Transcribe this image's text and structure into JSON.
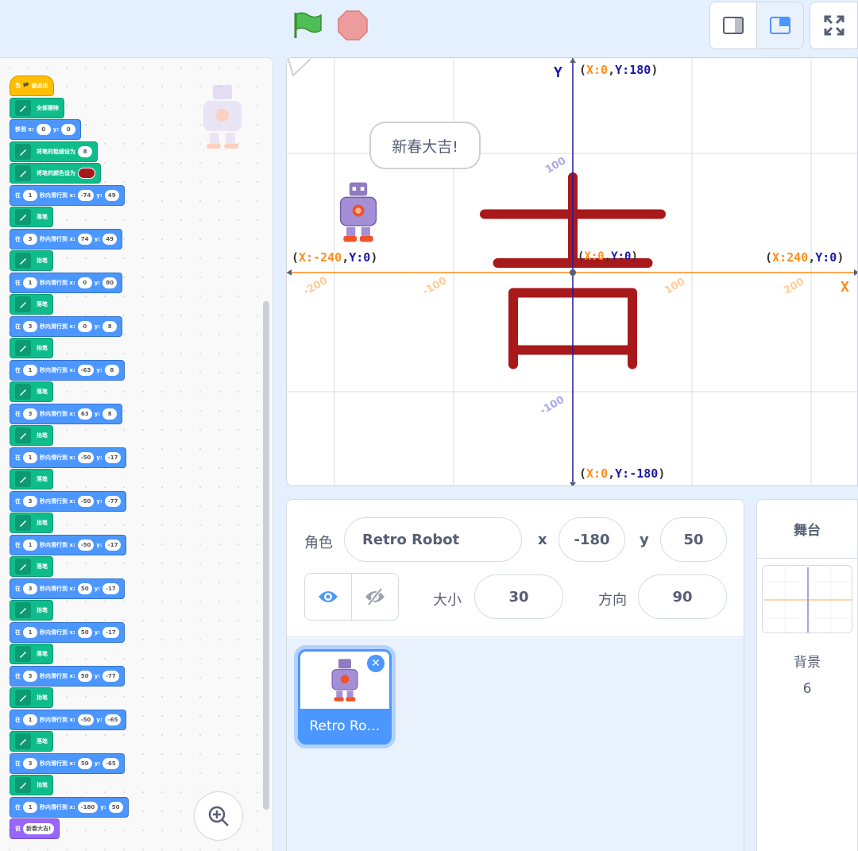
{
  "colors": {
    "accent": "#4c97ff",
    "pen": "#0fbd8c",
    "motion": "#4c97ff",
    "event": "#ffbf00",
    "looks": "#9966ff",
    "stroke": "#a8191b"
  },
  "toolbar": {
    "go_icon": "green-flag-icon",
    "stop_icon": "stop-icon"
  },
  "blocks": [
    {
      "cat": "event",
      "text": "当 🏴 被点击"
    },
    {
      "cat": "pen",
      "text": "全部擦除"
    },
    {
      "cat": "motion",
      "parts": [
        "移到 x:",
        {
          "v": "0"
        },
        "y:",
        {
          "v": "0"
        }
      ]
    },
    {
      "cat": "pen",
      "parts": [
        "将笔的粗细设为",
        {
          "v": "8"
        }
      ]
    },
    {
      "cat": "pen",
      "parts": [
        "将笔的颜色设为",
        {
          "color": "#a8191b"
        }
      ]
    },
    {
      "cat": "motion",
      "parts": [
        "在",
        {
          "v": "1"
        },
        "秒内滑行到 x:",
        {
          "v": "-74"
        },
        "y:",
        {
          "v": "49"
        }
      ]
    },
    {
      "cat": "pen",
      "text": "落笔"
    },
    {
      "cat": "motion",
      "parts": [
        "在",
        {
          "v": "3"
        },
        "秒内滑行到 x:",
        {
          "v": "74"
        },
        "y:",
        {
          "v": "49"
        }
      ]
    },
    {
      "cat": "pen",
      "text": "抬笔"
    },
    {
      "cat": "motion",
      "parts": [
        "在",
        {
          "v": "1"
        },
        "秒内滑行到 x:",
        {
          "v": "0"
        },
        "y:",
        {
          "v": "80"
        }
      ]
    },
    {
      "cat": "pen",
      "text": "落笔"
    },
    {
      "cat": "motion",
      "parts": [
        "在",
        {
          "v": "3"
        },
        "秒内滑行到 x:",
        {
          "v": "0"
        },
        "y:",
        {
          "v": "8"
        }
      ]
    },
    {
      "cat": "pen",
      "text": "抬笔"
    },
    {
      "cat": "motion",
      "parts": [
        "在",
        {
          "v": "1"
        },
        "秒内滑行到 x:",
        {
          "v": "-63"
        },
        "y:",
        {
          "v": "8"
        }
      ]
    },
    {
      "cat": "pen",
      "text": "落笔"
    },
    {
      "cat": "motion",
      "parts": [
        "在",
        {
          "v": "3"
        },
        "秒内滑行到 x:",
        {
          "v": "63"
        },
        "y:",
        {
          "v": "8"
        }
      ]
    },
    {
      "cat": "pen",
      "text": "抬笔"
    },
    {
      "cat": "motion",
      "parts": [
        "在",
        {
          "v": "1"
        },
        "秒内滑行到 x:",
        {
          "v": "-50"
        },
        "y:",
        {
          "v": "-17"
        }
      ]
    },
    {
      "cat": "pen",
      "text": "落笔"
    },
    {
      "cat": "motion",
      "parts": [
        "在",
        {
          "v": "3"
        },
        "秒内滑行到 x:",
        {
          "v": "-50"
        },
        "y:",
        {
          "v": "-77"
        }
      ]
    },
    {
      "cat": "pen",
      "text": "抬笔"
    },
    {
      "cat": "motion",
      "parts": [
        "在",
        {
          "v": "1"
        },
        "秒内滑行到 x:",
        {
          "v": "-50"
        },
        "y:",
        {
          "v": "-17"
        }
      ]
    },
    {
      "cat": "pen",
      "text": "落笔"
    },
    {
      "cat": "motion",
      "parts": [
        "在",
        {
          "v": "3"
        },
        "秒内滑行到 x:",
        {
          "v": "50"
        },
        "y:",
        {
          "v": "-17"
        }
      ]
    },
    {
      "cat": "pen",
      "text": "抬笔"
    },
    {
      "cat": "motion",
      "parts": [
        "在",
        {
          "v": "1"
        },
        "秒内滑行到 x:",
        {
          "v": "50"
        },
        "y:",
        {
          "v": "-17"
        }
      ]
    },
    {
      "cat": "pen",
      "text": "落笔"
    },
    {
      "cat": "motion",
      "parts": [
        "在",
        {
          "v": "3"
        },
        "秒内滑行到 x:",
        {
          "v": "50"
        },
        "y:",
        {
          "v": "-77"
        }
      ]
    },
    {
      "cat": "pen",
      "text": "抬笔"
    },
    {
      "cat": "motion",
      "parts": [
        "在",
        {
          "v": "1"
        },
        "秒内滑行到 x:",
        {
          "v": "-50"
        },
        "y:",
        {
          "v": "-65"
        }
      ]
    },
    {
      "cat": "pen",
      "text": "落笔"
    },
    {
      "cat": "motion",
      "parts": [
        "在",
        {
          "v": "3"
        },
        "秒内滑行到 x:",
        {
          "v": "50"
        },
        "y:",
        {
          "v": "-65"
        }
      ]
    },
    {
      "cat": "pen",
      "text": "抬笔"
    },
    {
      "cat": "motion",
      "parts": [
        "在",
        {
          "v": "1"
        },
        "秒内滑行到 x:",
        {
          "v": "-180"
        },
        "y:",
        {
          "v": "50"
        }
      ]
    },
    {
      "cat": "looks",
      "parts": [
        "说",
        {
          "v": "新春大吉!"
        }
      ]
    }
  ],
  "stage": {
    "speech": "新春大吉!",
    "y_axis_name": "Y",
    "x_axis_name": "X",
    "top_label": "(X:0,Y:180)",
    "bottom_label": "(X:0,Y:-180)",
    "left_label": "(X:-240,Y:0)",
    "right_label": "(X:240,Y:0)",
    "center_label": "(X:0,Y:0)",
    "x_ticks": [
      "-200",
      "-100",
      "100",
      "200"
    ],
    "y_ticks": [
      "100",
      "-100"
    ],
    "strokes": [
      {
        "from": [
          -74,
          49
        ],
        "to": [
          74,
          49
        ]
      },
      {
        "from": [
          0,
          80
        ],
        "to": [
          0,
          8
        ]
      },
      {
        "from": [
          -63,
          8
        ],
        "to": [
          63,
          8
        ]
      },
      {
        "from": [
          -50,
          -17
        ],
        "to": [
          -50,
          -77
        ]
      },
      {
        "from": [
          -50,
          -17
        ],
        "to": [
          50,
          -17
        ]
      },
      {
        "from": [
          50,
          -17
        ],
        "to": [
          50,
          -77
        ]
      },
      {
        "from": [
          -50,
          -65
        ],
        "to": [
          50,
          -65
        ]
      }
    ]
  },
  "sprite_info": {
    "sprite_label": "角色",
    "sprite_name": "Retro Robot",
    "x_label": "x",
    "x_value": "-180",
    "y_label": "y",
    "y_value": "50",
    "size_label": "大小",
    "size_value": "30",
    "direction_label": "方向",
    "direction_value": "90",
    "show_icon": "eye-icon",
    "hide_icon": "eye-slash-icon"
  },
  "sprite_list": [
    {
      "name": "Retro Ro…",
      "selected": true
    }
  ],
  "stage_panel": {
    "title": "舞台",
    "backdrops_label": "背景",
    "backdrops_count": "6"
  }
}
